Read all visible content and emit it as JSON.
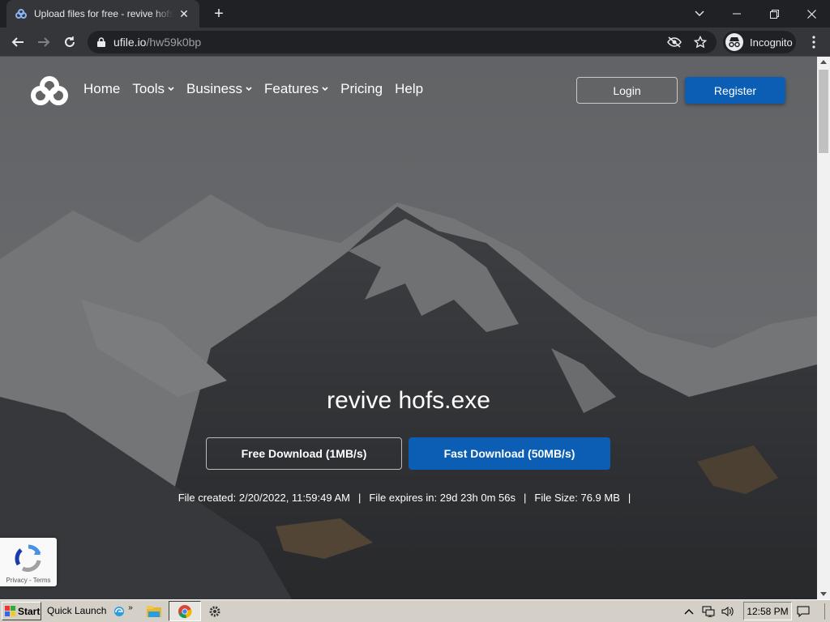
{
  "browser": {
    "tab_title": "Upload files for free - revive hofs.exe - ufile.io",
    "url_host": "ufile.io",
    "url_path": "/hw59k0bp",
    "profile_label": "Incognito"
  },
  "nav": {
    "items": [
      {
        "label": "Home",
        "has_dropdown": false
      },
      {
        "label": "Tools",
        "has_dropdown": true
      },
      {
        "label": "Business",
        "has_dropdown": true
      },
      {
        "label": "Features",
        "has_dropdown": true
      },
      {
        "label": "Pricing",
        "has_dropdown": false
      },
      {
        "label": "Help",
        "has_dropdown": false
      }
    ],
    "login_label": "Login",
    "register_label": "Register"
  },
  "file": {
    "name": "revive hofs.exe",
    "free_download_label": "Free Download (1MB/s)",
    "fast_download_label": "Fast Download (50MB/s)",
    "created": "File created: 2/20/2022, 11:59:49 AM",
    "expires": "File expires in: 29d 23h 0m 56s",
    "size": "File Size: 76.9 MB"
  },
  "recaptcha": {
    "terms": "Privacy - Terms"
  },
  "taskbar": {
    "start_label": "Start",
    "quick_launch_label": "Quick Launch",
    "clock": "12:58 PM"
  },
  "colors": {
    "accent_blue": "#0b5eb3",
    "browser_dark": "#202124",
    "browser_toolbar": "#35363a",
    "taskbar": "#d4d0c8"
  }
}
